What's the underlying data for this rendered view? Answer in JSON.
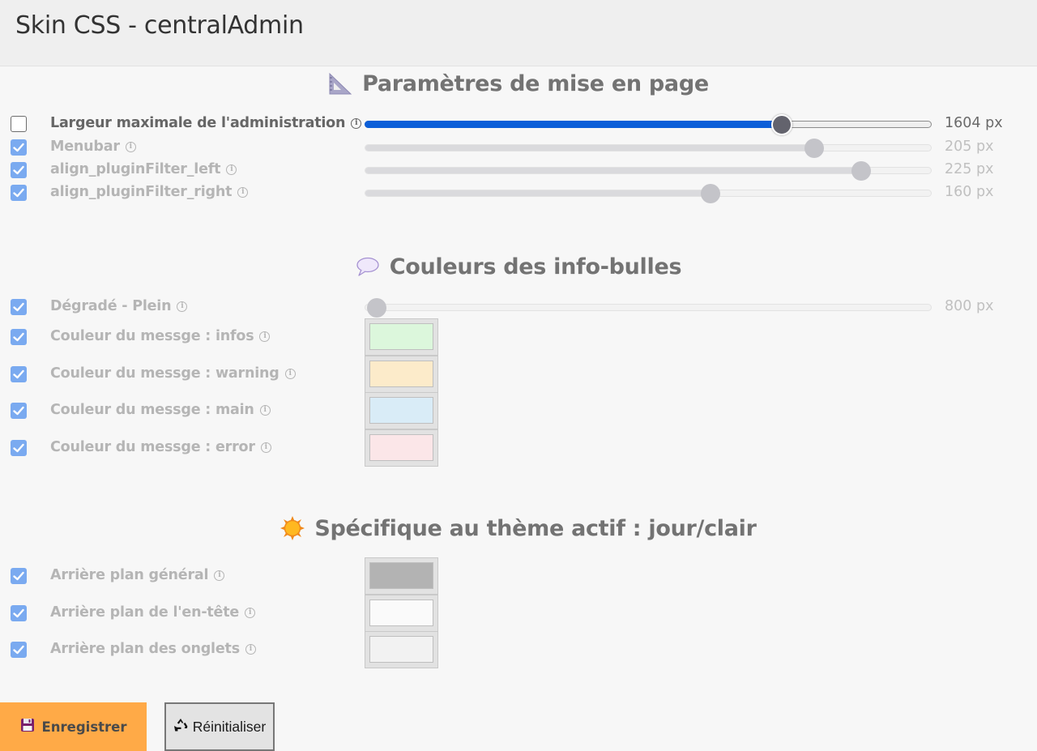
{
  "window": {
    "title": "Skin CSS - centralAdmin"
  },
  "sections": {
    "layout": {
      "title": "Paramètres de mise en page",
      "icon": "triangle-ruler-icon"
    },
    "tooltips": {
      "title": "Couleurs des info-bulles",
      "icon": "speech-bubble-icon"
    },
    "theme": {
      "title": "Spécifique au thème actif : jour/clair",
      "icon": "sun-icon"
    }
  },
  "layout_rows": [
    {
      "label": "Largeur maximale de l'administration",
      "checked": false,
      "value": "1604 px",
      "slider_fraction": 0.737
    },
    {
      "label": "Menubar",
      "checked": true,
      "value": "205 px",
      "slider_fraction": 0.794
    },
    {
      "label": "align_pluginFilter_left",
      "checked": true,
      "value": "225 px",
      "slider_fraction": 0.877
    },
    {
      "label": "align_pluginFilter_right",
      "checked": true,
      "value": "160 px",
      "slider_fraction": 0.611
    }
  ],
  "tooltip_rows": {
    "gradient": {
      "label": "Dégradé - Plein",
      "checked": true,
      "value": "800 px",
      "slider_fraction": 0.02
    },
    "colors": [
      {
        "label": "Couleur du messge : infos",
        "checked": true,
        "color": "#dcf7dc"
      },
      {
        "label": "Couleur du messge : warning",
        "checked": true,
        "color": "#fcebca"
      },
      {
        "label": "Couleur du messge : main",
        "checked": true,
        "color": "#d9ecf7"
      },
      {
        "label": "Couleur du messge : error",
        "checked": true,
        "color": "#fbe6e8"
      }
    ]
  },
  "theme_rows": [
    {
      "label": "Arrière plan général",
      "checked": true,
      "color": "#b3b3b3"
    },
    {
      "label": "Arrière plan de l'en-tête",
      "checked": true,
      "color": "#fafafa"
    },
    {
      "label": "Arrière plan des onglets",
      "checked": true,
      "color": "#f2f2f2"
    }
  ],
  "buttons": {
    "save": {
      "label": "Enregistrer",
      "icon": "floppy-disk-icon",
      "color": "#ffaa47"
    },
    "reset": {
      "label": "Réinitialiser",
      "icon": "recycle-icon"
    }
  },
  "colors": {
    "accent": "#0c5fd8",
    "checkbox": "#7aaaf0"
  }
}
